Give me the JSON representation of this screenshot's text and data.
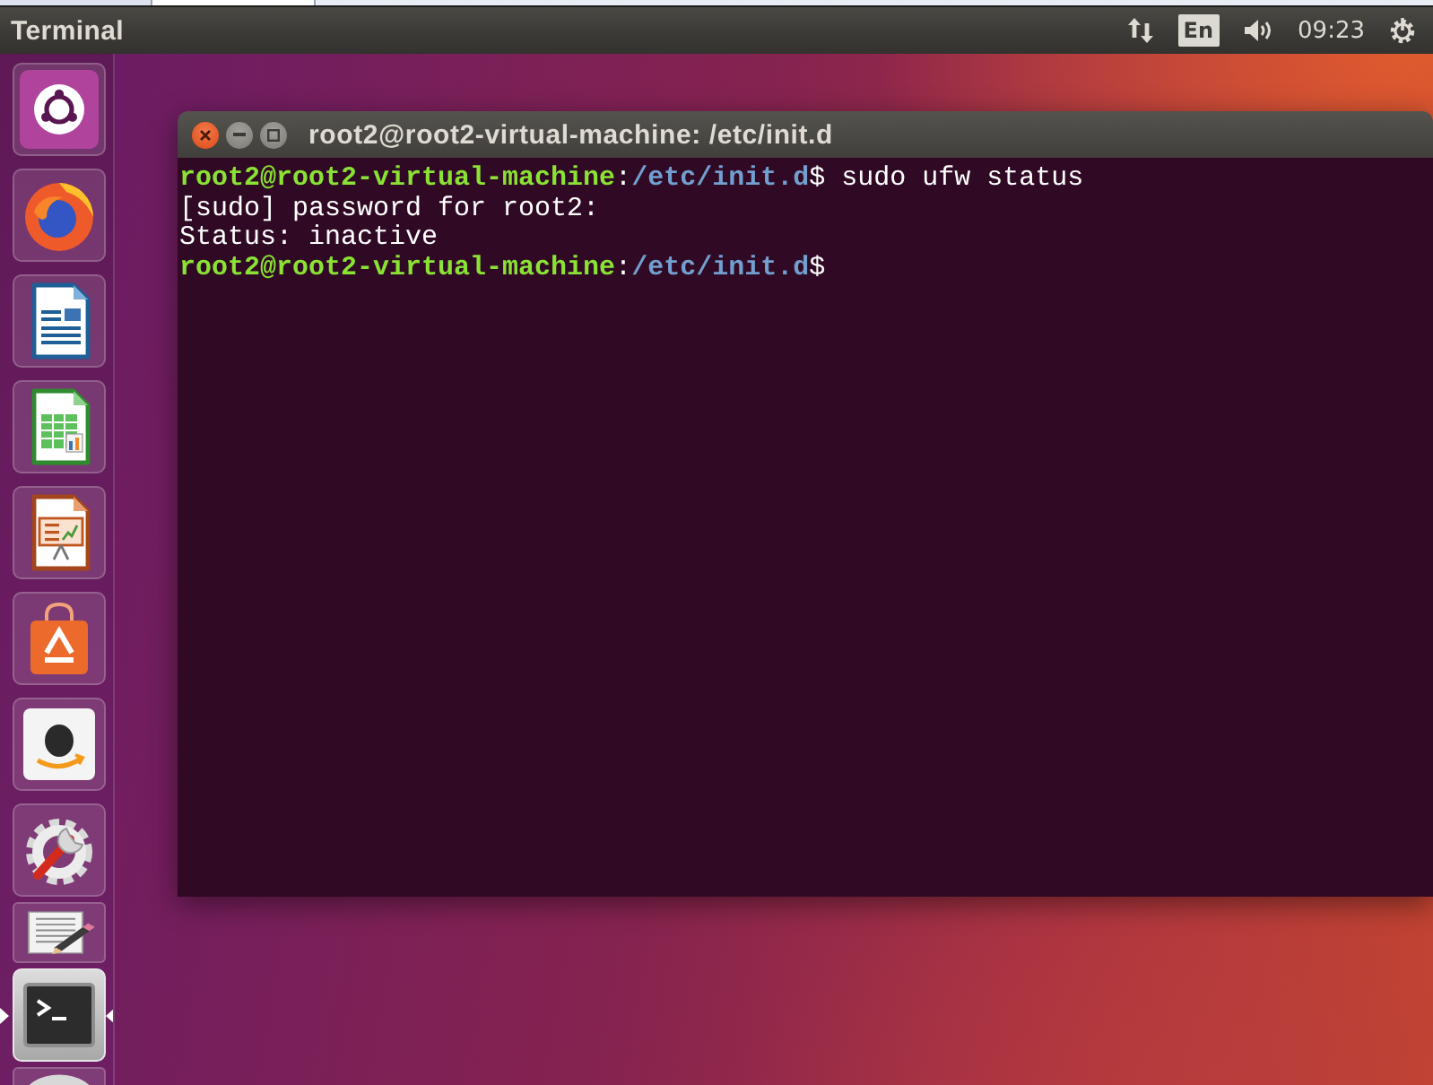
{
  "top_panel": {
    "app_title": "Terminal",
    "indicators": [
      {
        "kind": "network"
      },
      {
        "kind": "keyboard",
        "label": "En"
      },
      {
        "kind": "volume"
      },
      {
        "kind": "clock",
        "label": "09:23"
      },
      {
        "kind": "system"
      }
    ]
  },
  "launcher": {
    "items": [
      {
        "kind": "dash",
        "running": false,
        "selected": false,
        "folded": false
      },
      {
        "kind": "browser",
        "running": false,
        "selected": false,
        "folded": false
      },
      {
        "kind": "writer",
        "running": false,
        "selected": false,
        "folded": false
      },
      {
        "kind": "calc",
        "running": false,
        "selected": false,
        "folded": false
      },
      {
        "kind": "impress",
        "running": false,
        "selected": false,
        "folded": false
      },
      {
        "kind": "store",
        "running": false,
        "selected": false,
        "folded": false
      },
      {
        "kind": "shop",
        "running": false,
        "selected": false,
        "folded": false
      },
      {
        "kind": "settings",
        "running": false,
        "selected": false,
        "folded": false
      },
      {
        "kind": "editor",
        "running": false,
        "selected": false,
        "folded": true
      },
      {
        "kind": "terminal",
        "running": true,
        "selected": true,
        "folded": false
      },
      {
        "kind": "disc",
        "running": false,
        "selected": false,
        "folded": true
      }
    ]
  },
  "terminal_window": {
    "title": "root2@root2-virtual-machine: /etc/init.d",
    "buttons": [
      {
        "kind": "close"
      },
      {
        "kind": "minimize"
      },
      {
        "kind": "maximize"
      }
    ],
    "lines": [
      {
        "segments": [
          {
            "kind": "user",
            "text": "root2@root2-virtual-machine"
          },
          {
            "kind": "plain",
            "text": ":"
          },
          {
            "kind": "path",
            "text": "/etc/init.d"
          },
          {
            "kind": "plain",
            "text": "$ sudo ufw status"
          }
        ]
      },
      {
        "segments": [
          {
            "kind": "plain",
            "text": "[sudo] password for root2:"
          }
        ]
      },
      {
        "segments": [
          {
            "kind": "plain",
            "text": "Status: inactive"
          }
        ]
      },
      {
        "segments": [
          {
            "kind": "user",
            "text": "root2@root2-virtual-machine"
          },
          {
            "kind": "plain",
            "text": ":"
          },
          {
            "kind": "path",
            "text": "/etc/init.d"
          },
          {
            "kind": "plain",
            "text": "$"
          }
        ]
      }
    ]
  }
}
